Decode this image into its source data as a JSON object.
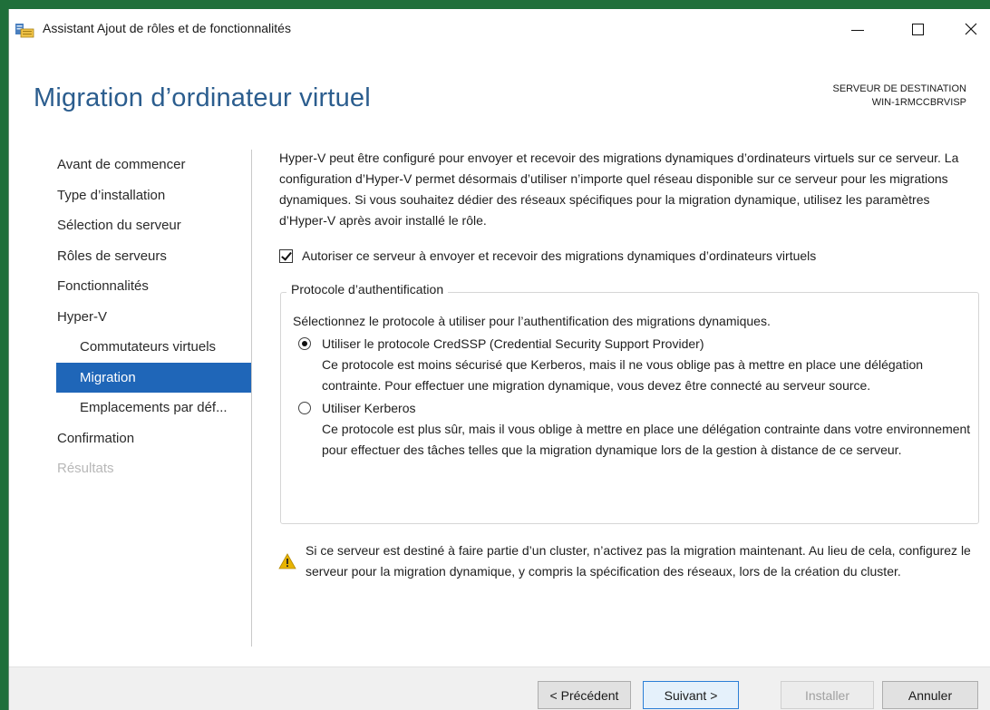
{
  "window": {
    "title": "Assistant Ajout de rôles et de fonctionnalités"
  },
  "header": {
    "page_title": "Migration d’ordinateur virtuel",
    "dest_label": "SERVEUR DE DESTINATION",
    "dest_server": "WIN-1RMCCBRVISP"
  },
  "nav": {
    "items": [
      {
        "label": "Avant de commencer"
      },
      {
        "label": "Type d’installation"
      },
      {
        "label": "Sélection du serveur"
      },
      {
        "label": "Rôles de serveurs"
      },
      {
        "label": "Fonctionnalités"
      },
      {
        "label": "Hyper-V"
      },
      {
        "label": "Commutateurs virtuels"
      },
      {
        "label": "Migration"
      },
      {
        "label": "Emplacements par déf..."
      },
      {
        "label": "Confirmation"
      },
      {
        "label": "Résultats"
      }
    ]
  },
  "main": {
    "intro": "Hyper-V peut être configuré pour envoyer et recevoir des migrations dynamiques d’ordinateurs virtuels sur ce serveur. La configuration d’Hyper-V permet désormais d’utiliser n’importe quel réseau disponible sur ce serveur pour les migrations dynamiques. Si vous souhaitez dédier des réseaux spécifiques pour la migration dynamique, utilisez les paramètres d’Hyper-V après avoir installé le rôle.",
    "allow_checkbox_label": "Autoriser ce serveur à envoyer et recevoir des migrations dynamiques d’ordinateurs virtuels",
    "auth": {
      "legend": "Protocole d’authentification",
      "prompt": "Sélectionnez le protocole à utiliser pour l’authentification des migrations dynamiques.",
      "credssp_label": "Utiliser le protocole CredSSP (Credential Security Support Provider)",
      "credssp_desc": "Ce protocole est moins sécurisé que Kerberos, mais il ne vous oblige pas à mettre en place une délégation contrainte. Pour effectuer une migration dynamique, vous devez être connecté au serveur source.",
      "kerberos_label": "Utiliser Kerberos",
      "kerberos_desc": "Ce protocole est plus sûr, mais il vous oblige à mettre en place une délégation contrainte dans votre environnement pour effectuer des tâches telles que la migration dynamique lors de la gestion à distance de ce serveur."
    },
    "warning": "Si ce serveur est destiné à faire partie d’un cluster, n’activez pas la migration maintenant. Au lieu de cela, configurez le serveur pour la migration dynamique, y compris la spécification des réseaux, lors de la création du cluster."
  },
  "footer": {
    "prev": "< Précédent",
    "next": "Suivant >",
    "install": "Installer",
    "cancel": "Annuler"
  },
  "colors": {
    "title_blue": "#2b5d8e",
    "nav_active_bg": "#1f66b8",
    "warning_yellow": "#e8b400"
  },
  "icons": [
    "server-manager-icon",
    "minimize-icon",
    "maximize-icon",
    "close-icon",
    "warning-icon"
  ]
}
